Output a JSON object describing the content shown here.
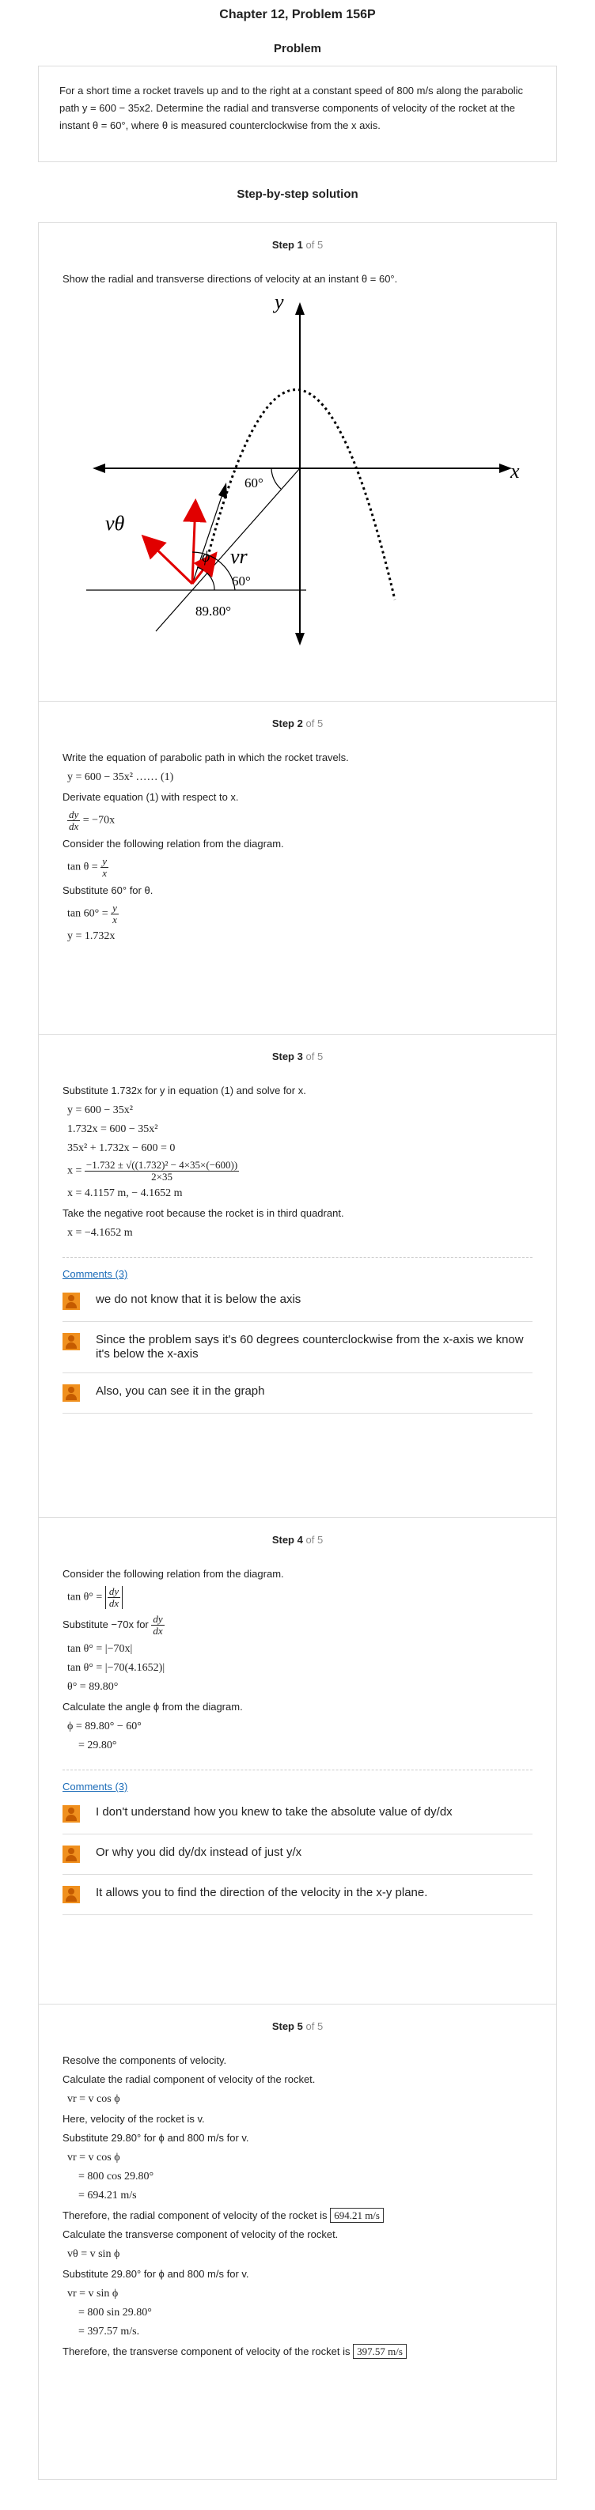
{
  "header": {
    "title": "Chapter 12, Problem 156P",
    "subtitle": "Problem"
  },
  "problem": {
    "text": "For a short time a rocket travels up and to the right at a constant speed of 800 m/s along the parabolic path y = 600 − 35x2. Determine the radial and transverse components of velocity of the rocket at the instant θ = 60°, where θ is measured counterclockwise from the x axis."
  },
  "solution_title": "Step-by-step solution",
  "step_word": "Step",
  "of_total": "of 5",
  "steps": [
    {
      "num": "1",
      "intro": "Show the radial and transverse directions of velocity at an instant  θ = 60°.",
      "diagram": {
        "y_label": "y",
        "x_label": "x",
        "angle60_top": "60°",
        "phi": "ϕ",
        "v_theta": "vθ",
        "v_r": "vr",
        "angle60_bottom": "60°",
        "angle89": "89.80°"
      }
    },
    {
      "num": "2",
      "lines": [
        "Write the equation of parabolic path in which the rocket travels.",
        "y = 600 − 35x²  …… (1)",
        "Derivate equation (1) with respect to x.",
        "= −70x",
        "Consider the following relation from the diagram.",
        "tan θ =",
        "Substitute  60° for θ.",
        "tan 60° =",
        "y = 1.732x"
      ],
      "frac": {
        "dy": "dy",
        "dx": "dx",
        "y": "y",
        "x": "x"
      }
    },
    {
      "num": "3",
      "lines": [
        "Substitute  1.732x for y in equation (1) and solve for x.",
        "y = 600 − 35x²",
        "1.732x = 600 − 35x²",
        "35x² + 1.732x − 600 = 0",
        "x =",
        "−1.732 ± √((1.732)² − 4×35×(−600))",
        "2×35",
        "x = 4.1157 m, − 4.1652 m",
        "Take the negative root because the rocket is in third quadrant.",
        "x = −4.1652 m"
      ],
      "comments_link": "Comments (3)",
      "comments": [
        "we do not know that it is below the axis",
        "Since the problem says it's 60 degrees counterclockwise from the x-axis we know it's below the x-axis",
        "Also, you can see it in the graph"
      ]
    },
    {
      "num": "4",
      "lines": [
        "Consider the following relation from the diagram.",
        "tan θ° =",
        "Substitute  −70x for",
        "tan θ° = |−70x|",
        "tan θ° = |−70(4.1652)|",
        "θ° = 89.80°",
        "Calculate the angle  ϕ  from the diagram.",
        "ϕ = 89.80° − 60°",
        "= 29.80°"
      ],
      "comments_link": "Comments (3)",
      "comments": [
        "I don't understand how you knew to take the absolute value of dy/dx",
        "Or why you did dy/dx instead of just y/x",
        "It allows you to find the direction of the velocity in the x-y plane."
      ]
    },
    {
      "num": "5",
      "lines": [
        "Resolve the components of velocity.",
        "Calculate the radial component of velocity of the rocket.",
        "vr = v cos ϕ",
        "Here, velocity of the rocket is  v.",
        "Substitute  29.80° for  ϕ  and  800 m/s for v.",
        "vr = v cos ϕ",
        "= 800 cos 29.80°",
        "= 694.21 m/s",
        "Therefore, the radial component of velocity of the rocket is",
        "694.21 m/s",
        "Calculate the transverse component of velocity of the rocket.",
        "vθ = v sin ϕ",
        "Substitute  29.80° for  ϕ  and  800 m/s for v.",
        "vr = v sin ϕ",
        "= 800 sin 29.80°",
        "= 397.57 m/s.",
        "Therefore, the transverse component of velocity of the rocket is",
        "397.57 m/s"
      ]
    }
  ]
}
